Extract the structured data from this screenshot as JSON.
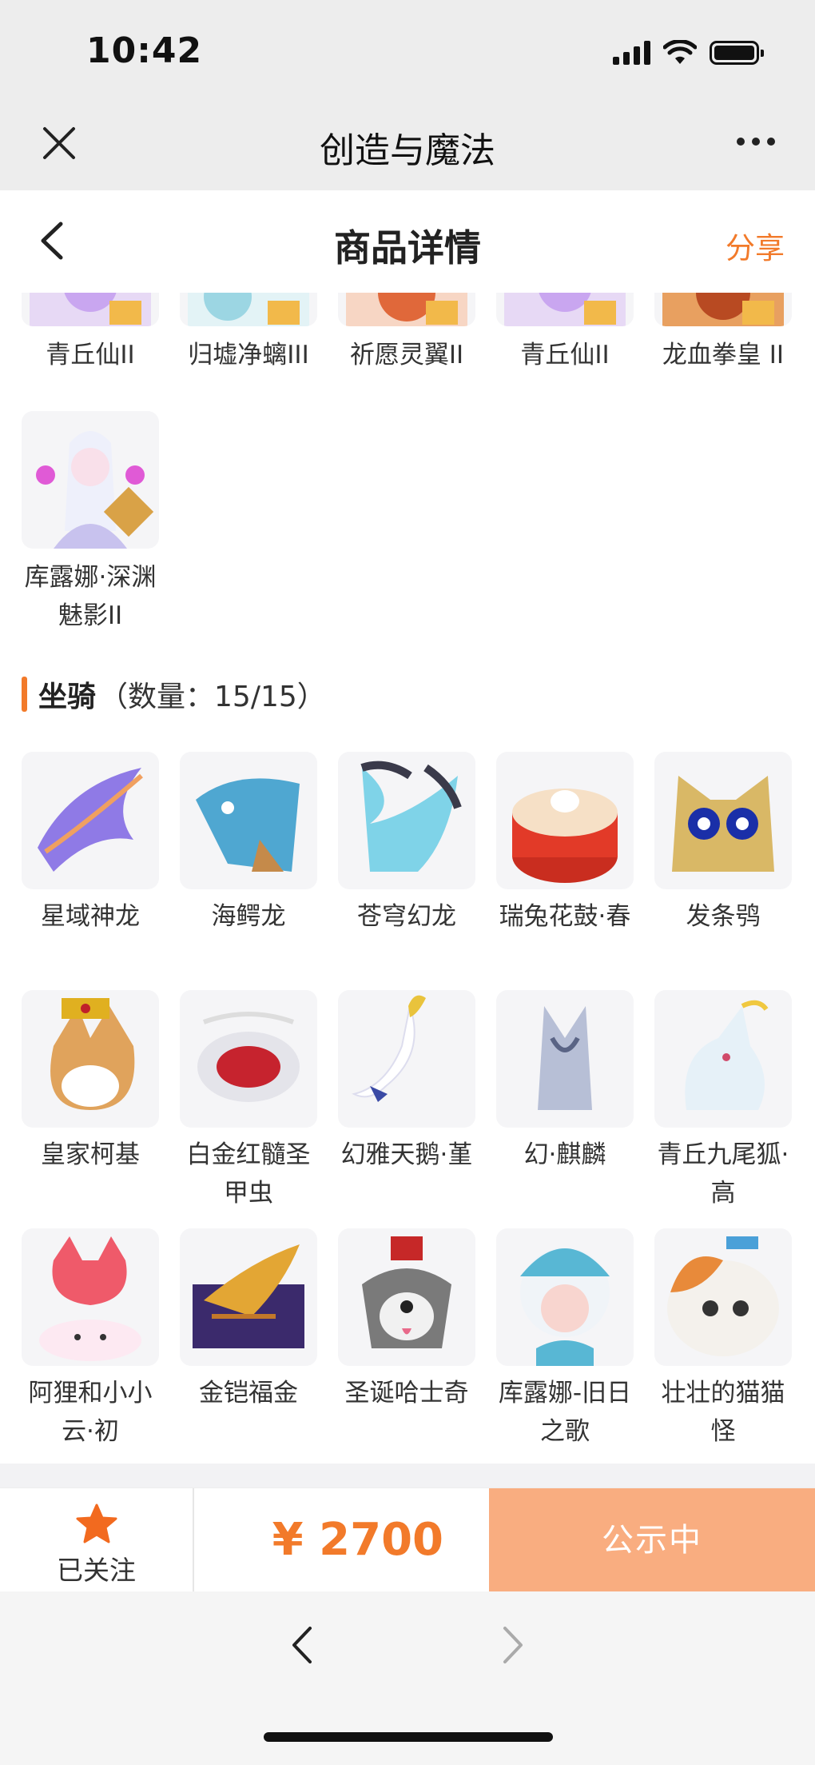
{
  "status_bar": {
    "time": "10:42"
  },
  "mini_program": {
    "title": "创造与魔法"
  },
  "nav": {
    "title": "商品详情",
    "share_label": "分享"
  },
  "prev_section": {
    "items": [
      {
        "name": "青丘仙II"
      },
      {
        "name": "归墟净螭III"
      },
      {
        "name": "祈愿灵翼II"
      },
      {
        "name": "青丘仙II"
      },
      {
        "name": "龙血拳皇 II"
      },
      {
        "name": "库露娜·深渊魅影II"
      }
    ]
  },
  "mounts": {
    "title": "坐骑",
    "count_label": "（数量：15/15）",
    "items": [
      {
        "name": "星域神龙"
      },
      {
        "name": "海鳄龙"
      },
      {
        "name": "苍穹幻龙"
      },
      {
        "name": "瑞兔花鼓·春"
      },
      {
        "name": "发条鸮"
      },
      {
        "name": "皇家柯基"
      },
      {
        "name": "白金红髓圣甲虫"
      },
      {
        "name": "幻雅天鹅·堇"
      },
      {
        "name": "幻·麒麟"
      },
      {
        "name": "青丘九尾狐·高"
      },
      {
        "name": "阿狸和小小云·初"
      },
      {
        "name": "金铠福金"
      },
      {
        "name": "圣诞哈士奇"
      },
      {
        "name": "库露娜-旧日之歌"
      },
      {
        "name": "壮壮的猫猫怪"
      }
    ]
  },
  "action_bar": {
    "follow_label": "已关注",
    "price": "¥ 2700",
    "status_button": "公示中"
  },
  "colors": {
    "accent": "#f27a2a",
    "status_button_bg": "#f9ad80"
  }
}
